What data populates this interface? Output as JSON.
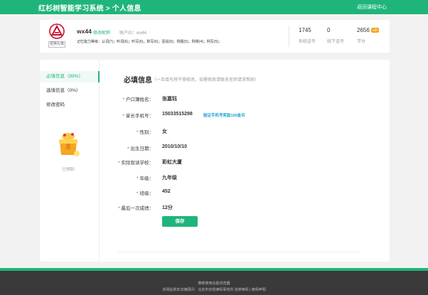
{
  "header": {
    "title": "红杉树智能学习系统 > 个人信息",
    "back_link": "返回课程中心"
  },
  "profile": {
    "avatar_icon": "logo-triangle-icon",
    "change_avatar": "更换头像",
    "username": "wx44",
    "edit_nickname": "修改昵称",
    "account_id": "账户ID：wx44",
    "abilities": "记忆能力等级：认词(7)；听词(6)；听写(6)；默写(6)；回说(0)；例题(5)；例课(4)；例写(5)；",
    "stats": [
      {
        "value": "1745",
        "label": "系统金币"
      },
      {
        "value": "0",
        "label": "线下金币"
      },
      {
        "value": "2656",
        "label": "学分",
        "badge": "VIP"
      }
    ]
  },
  "sidebar": {
    "items": [
      {
        "label": "必填信息（89%）"
      },
      {
        "label": "选填信息（0%）"
      },
      {
        "label": "修改密码"
      }
    ],
    "reward_status": "已领取！"
  },
  "form": {
    "title": "必填信息",
    "note": "（一旦填写将不得修改，如需修改请联系老师请求帮助）",
    "fields": [
      {
        "label": "户口簿姓名：",
        "value": "张嘉钰"
      },
      {
        "label": "家长手机号：",
        "value": "15033515298",
        "extra": "验证手机号奖励100金币"
      },
      {
        "label": "性别：",
        "value": "女"
      },
      {
        "label": "出生日期：",
        "value": "2010/10/10"
      },
      {
        "label": "实际就读学校：",
        "value": "彩虹大厦"
      },
      {
        "label": "年级：",
        "value": "九年级"
      },
      {
        "label": "班级：",
        "value": "452"
      },
      {
        "label": "最后一次成绩：",
        "value": "12分"
      }
    ],
    "save_label": "保存"
  },
  "footer": {
    "line1": "推荐使用谷歌浏览器",
    "line2": "本网站常年法律顾问：北京市京悦律师事务所 张婷律师 | 律师声明"
  },
  "colors": {
    "brand": "#1fb57a",
    "link": "#1fa0d8",
    "required": "#e34",
    "badge": "#f5a623"
  }
}
